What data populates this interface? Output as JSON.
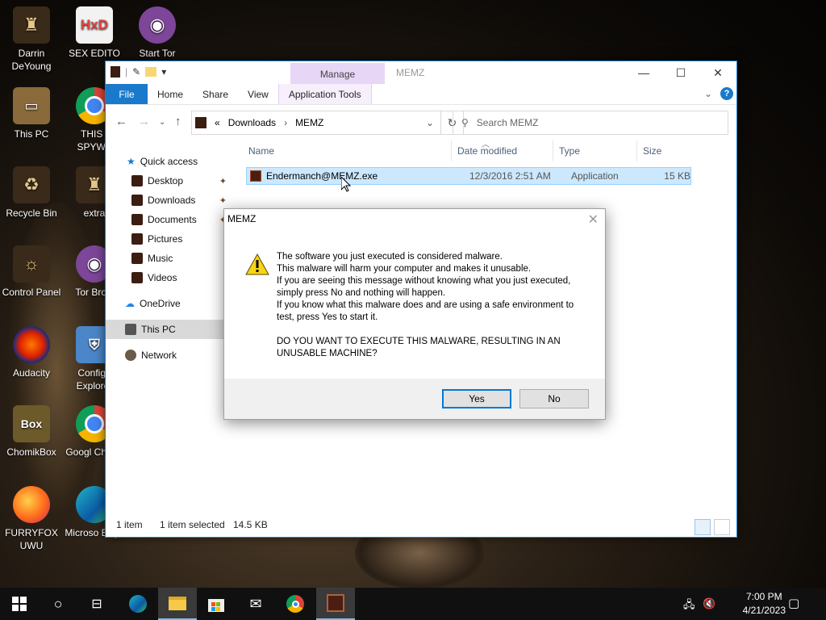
{
  "desktop": {
    "icons": [
      {
        "label": "Darrin DeYoung",
        "icon": "user-folder-icon"
      },
      {
        "label": "SEX EDITO",
        "icon": "hxd-icon"
      },
      {
        "label": "Start Tor",
        "icon": "tor-icon"
      },
      {
        "label": "This PC",
        "icon": "this-pc-icon"
      },
      {
        "label": "THIS I SPYWA",
        "icon": "chrome-icon"
      },
      {
        "label": "Recycle Bin",
        "icon": "recycle-bin-icon"
      },
      {
        "label": "extra",
        "icon": "folder-icon"
      },
      {
        "label": "Control Panel",
        "icon": "control-panel-icon"
      },
      {
        "label": "Tor Brow",
        "icon": "tor-icon"
      },
      {
        "label": "Audacity",
        "icon": "audacity-icon"
      },
      {
        "label": "Configu Explorer",
        "icon": "shield-icon"
      },
      {
        "label": "ChomikBox",
        "icon": "chomikbox-icon"
      },
      {
        "label": "Googl Chrom",
        "icon": "chrome-icon"
      },
      {
        "label": "FURRYFOX UWU",
        "icon": "firefox-icon"
      },
      {
        "label": "Microso Edge",
        "icon": "edge-icon"
      }
    ]
  },
  "explorer": {
    "title": "MEMZ",
    "manage_tab": "Manage",
    "ribbon_tabs": [
      "File",
      "Home",
      "Share",
      "View",
      "Application Tools"
    ],
    "breadcrumb": {
      "prefix": "«",
      "items": [
        "Downloads",
        "MEMZ"
      ]
    },
    "search_placeholder": "Search MEMZ",
    "nav": {
      "quick_access": "Quick access",
      "items": [
        "Desktop",
        "Downloads",
        "Documents",
        "Pictures",
        "Music",
        "Videos"
      ],
      "onedrive": "OneDrive",
      "this_pc": "This PC",
      "network": "Network"
    },
    "columns": [
      "Name",
      "Date modified",
      "Type",
      "Size"
    ],
    "files": [
      {
        "name": "Endermanch@MEMZ.exe",
        "date": "12/3/2016 2:51 AM",
        "type": "Application",
        "size": "15 KB"
      }
    ],
    "status": {
      "count": "1 item",
      "selected": "1 item selected",
      "size": "14.5 KB"
    }
  },
  "dialog": {
    "title": "MEMZ",
    "lines": [
      "The software you just executed is considered malware.",
      "This malware will harm your computer and makes it unusable.",
      "If you are seeing this message without knowing what you just executed,",
      "simply press No and nothing will happen.",
      "If you know what this malware does and are using a safe environment to",
      "test, press Yes to start it."
    ],
    "question_line1": "DO YOU WANT TO EXECUTE THIS MALWARE, RESULTING IN AN",
    "question_line2": "UNUSABLE MACHINE?",
    "yes_label": "Yes",
    "no_label": "No"
  },
  "taskbar": {
    "time": "7:00 PM",
    "date": "4/21/2023"
  }
}
